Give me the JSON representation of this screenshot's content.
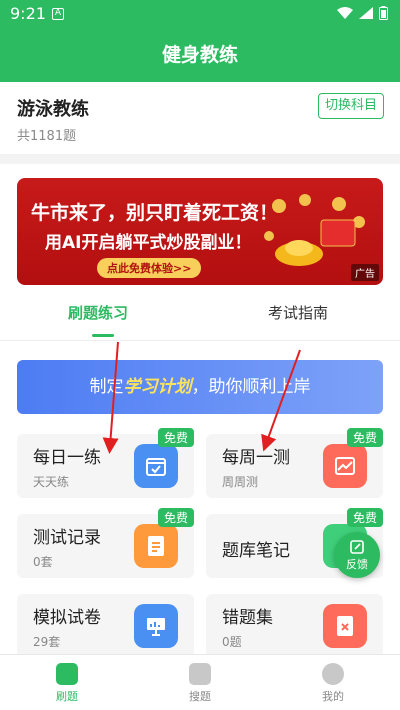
{
  "status": {
    "time": "9:21",
    "notif_icon": "A"
  },
  "header": {
    "title": "健身教练"
  },
  "subject": {
    "name": "游泳教练",
    "count": "共1181题",
    "switch_label": "切换科目"
  },
  "banner": {
    "line1": "牛市来了，别只盯着死工资！",
    "line2": "用AI开启躺平式炒股副业！",
    "cta": "点此免费体验>>",
    "ad_tag": "广告"
  },
  "tabs": [
    {
      "label": "刷题练习",
      "active": true
    },
    {
      "label": "考试指南",
      "active": false
    }
  ],
  "plan": {
    "prefix": "制定",
    "highlight": "学习计划",
    "suffix": "，助你顺利上岸"
  },
  "cards": [
    {
      "title": "每日一练",
      "subtitle": "天天练",
      "free": "免费",
      "icon": "calendar-check-icon",
      "color": "#4a90f2"
    },
    {
      "title": "每周一测",
      "subtitle": "周周测",
      "free": "免费",
      "icon": "chart-icon",
      "color": "#ff6b5a"
    },
    {
      "title": "测试记录",
      "subtitle": "0套",
      "free": "免费",
      "icon": "document-icon",
      "color": "#ff9a3c"
    },
    {
      "title": "题库笔记",
      "subtitle": "",
      "free": "免费",
      "icon": "notebook-icon",
      "color": "#3fcf7a"
    },
    {
      "title": "模拟试卷",
      "subtitle": "29套",
      "free": "",
      "icon": "presentation-icon",
      "color": "#4a90f2"
    },
    {
      "title": "错题集",
      "subtitle": "0题",
      "free": "",
      "icon": "wrong-file-icon",
      "color": "#ff6b5a"
    }
  ],
  "feedback": {
    "label": "反馈"
  },
  "nav": [
    {
      "label": "刷题",
      "active": true
    },
    {
      "label": "搜题",
      "active": false
    },
    {
      "label": "我的",
      "active": false
    }
  ],
  "colors": {
    "brand": "#2dbb62",
    "banner_red": "#c71a1a",
    "plan_blue": "#4d7cf3"
  }
}
